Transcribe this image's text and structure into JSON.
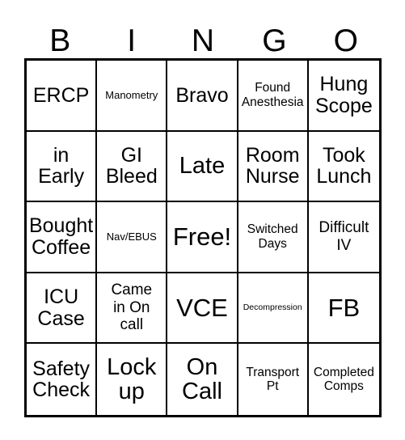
{
  "card": {
    "title": "BINGO",
    "header_letters": [
      "B",
      "I",
      "N",
      "G",
      "O"
    ],
    "columns": 5,
    "rows": 5,
    "free_space_label": "Free!",
    "free_space_position": "row3-col3",
    "colors": {
      "background": "#ffffff",
      "text": "#000000",
      "grid_line": "#000000"
    },
    "cells": [
      {
        "text": "ERCP",
        "size": "fs-lg",
        "row": 1,
        "col": 1,
        "column_letter": "B"
      },
      {
        "text": "Manometry",
        "size": "fs-sm",
        "row": 1,
        "col": 2,
        "column_letter": "I"
      },
      {
        "text": "Bravo",
        "size": "fs-lg",
        "row": 1,
        "col": 3,
        "column_letter": "N"
      },
      {
        "text": "Found\nAnesthesia",
        "size": "fs-md",
        "row": 1,
        "col": 4,
        "column_letter": "G"
      },
      {
        "text": "Hung\nScope",
        "size": "fs-lg",
        "row": 1,
        "col": 5,
        "column_letter": "O"
      },
      {
        "text": "in\nEarly",
        "size": "fs-lg",
        "row": 2,
        "col": 1,
        "column_letter": "B"
      },
      {
        "text": "GI\nBleed",
        "size": "fs-lg",
        "row": 2,
        "col": 2,
        "column_letter": "I"
      },
      {
        "text": "Late",
        "size": "fs-xl",
        "row": 2,
        "col": 3,
        "column_letter": "N"
      },
      {
        "text": "Room\nNurse",
        "size": "fs-lg",
        "row": 2,
        "col": 4,
        "column_letter": "G"
      },
      {
        "text": "Took\nLunch",
        "size": "fs-lg",
        "row": 2,
        "col": 5,
        "column_letter": "O"
      },
      {
        "text": "Bought\nCoffee",
        "size": "fs-lg",
        "row": 3,
        "col": 1,
        "column_letter": "B"
      },
      {
        "text": "Nav/EBUS",
        "size": "fs-sm",
        "row": 3,
        "col": 2,
        "column_letter": "I"
      },
      {
        "text": "Free!",
        "size": "fs-xxl",
        "row": 3,
        "col": 3,
        "column_letter": "N"
      },
      {
        "text": "Switched\nDays",
        "size": "fs-md",
        "row": 3,
        "col": 4,
        "column_letter": "G"
      },
      {
        "text": "Difficult\nIV",
        "size": "fs-ml",
        "row": 3,
        "col": 5,
        "column_letter": "O"
      },
      {
        "text": "ICU\nCase",
        "size": "fs-lg",
        "row": 4,
        "col": 1,
        "column_letter": "B"
      },
      {
        "text": "Came\nin On\ncall",
        "size": "fs-ml",
        "row": 4,
        "col": 2,
        "column_letter": "I"
      },
      {
        "text": "VCE",
        "size": "fs-xxl",
        "row": 4,
        "col": 3,
        "column_letter": "N"
      },
      {
        "text": "Decompression",
        "size": "fs-xs",
        "row": 4,
        "col": 4,
        "column_letter": "G"
      },
      {
        "text": "FB",
        "size": "fs-xxl",
        "row": 4,
        "col": 5,
        "column_letter": "O"
      },
      {
        "text": "Safety\nCheck",
        "size": "fs-lg",
        "row": 5,
        "col": 1,
        "column_letter": "B"
      },
      {
        "text": "Lock\nup",
        "size": "fs-xl",
        "row": 5,
        "col": 2,
        "column_letter": "I"
      },
      {
        "text": "On\nCall",
        "size": "fs-xl",
        "row": 5,
        "col": 3,
        "column_letter": "N"
      },
      {
        "text": "Transport\nPt",
        "size": "fs-md",
        "row": 5,
        "col": 4,
        "column_letter": "G"
      },
      {
        "text": "Completed\nComps",
        "size": "fs-md",
        "row": 5,
        "col": 5,
        "column_letter": "O"
      }
    ]
  }
}
